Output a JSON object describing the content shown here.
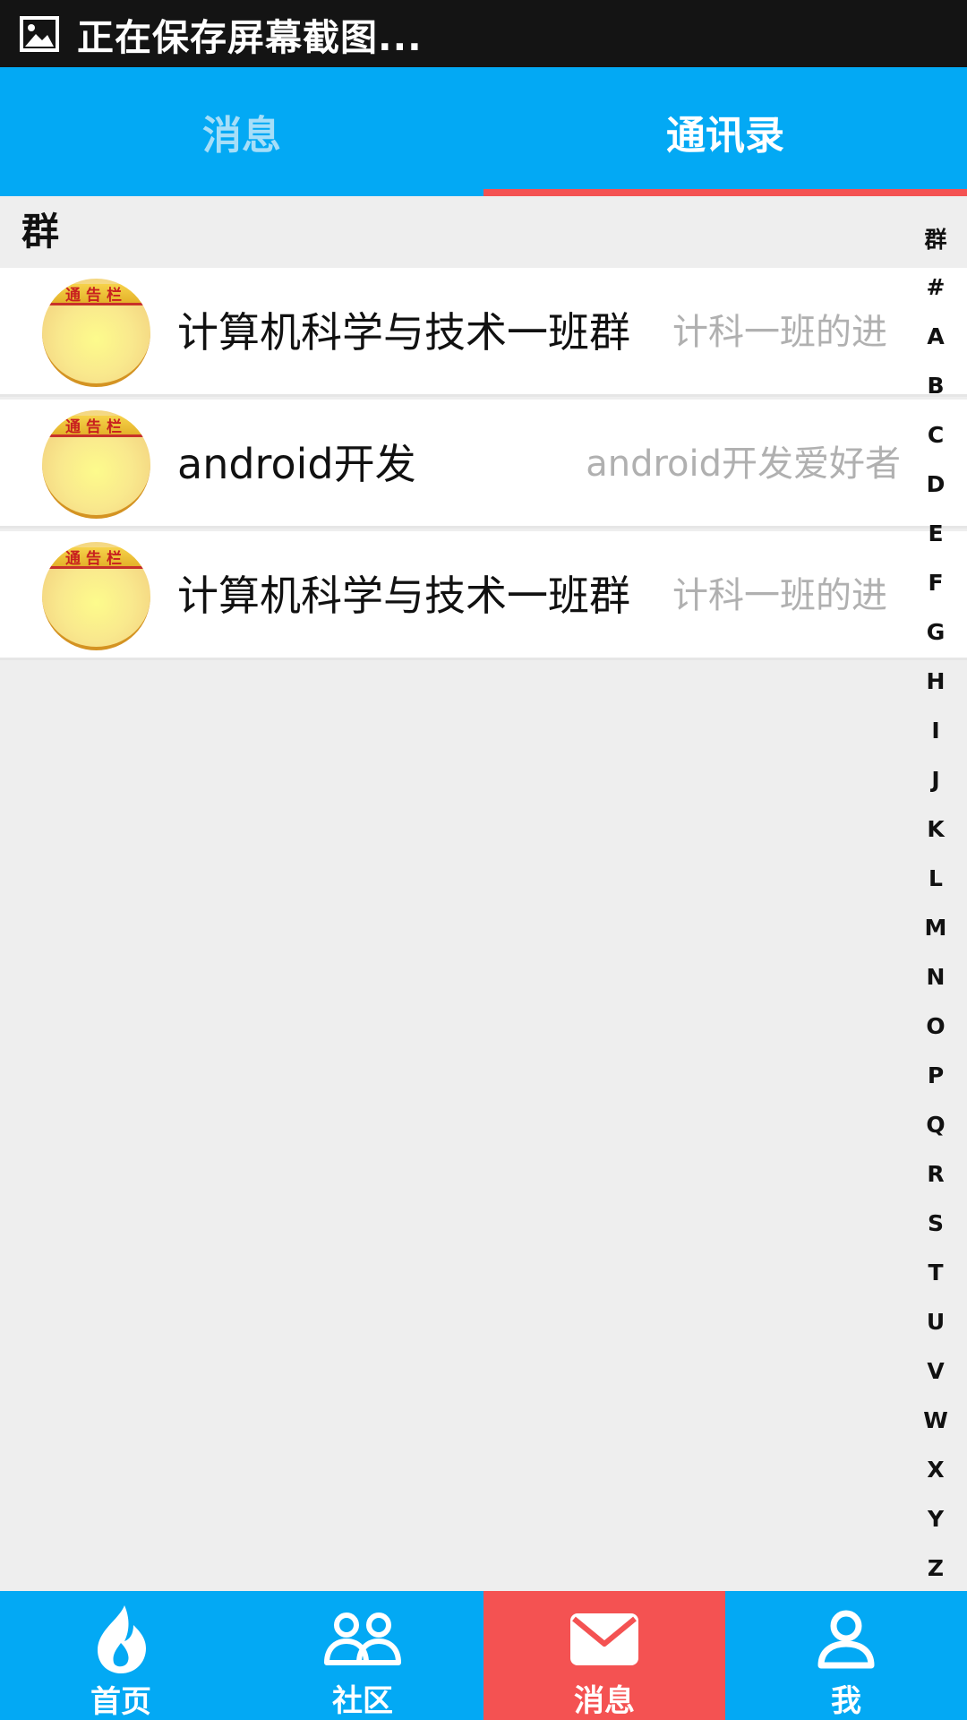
{
  "status_bar": {
    "icon": "image-icon",
    "text": "正在保存屏幕截图..."
  },
  "top_tabs": [
    {
      "label": "消息",
      "active": false
    },
    {
      "label": "通讯录",
      "active": true
    }
  ],
  "section": {
    "title": "群"
  },
  "groups": [
    {
      "avatar_text": "通告栏",
      "name": "计算机科学与技术一班群",
      "desc": "计科一班的进"
    },
    {
      "avatar_text": "通告栏",
      "name": "android开发",
      "desc": "android开发爱好者"
    },
    {
      "avatar_text": "通告栏",
      "name": "计算机科学与技术一班群",
      "desc": "计科一班的进"
    }
  ],
  "index_letters": [
    "群",
    "#",
    "A",
    "B",
    "C",
    "D",
    "E",
    "F",
    "G",
    "H",
    "I",
    "J",
    "K",
    "L",
    "M",
    "N",
    "O",
    "P",
    "Q",
    "R",
    "S",
    "T",
    "U",
    "V",
    "W",
    "X",
    "Y",
    "Z"
  ],
  "bottom_nav": [
    {
      "label": "首页",
      "icon": "flame-icon",
      "active": false
    },
    {
      "label": "社区",
      "icon": "people-icon",
      "active": false
    },
    {
      "label": "消息",
      "icon": "envelope-icon",
      "active": true
    },
    {
      "label": "我",
      "icon": "person-icon",
      "active": false
    }
  ],
  "colors": {
    "primary": "#03a9f4",
    "accent": "#f45252",
    "status_bar": "#141414",
    "background": "#eeeeee"
  }
}
